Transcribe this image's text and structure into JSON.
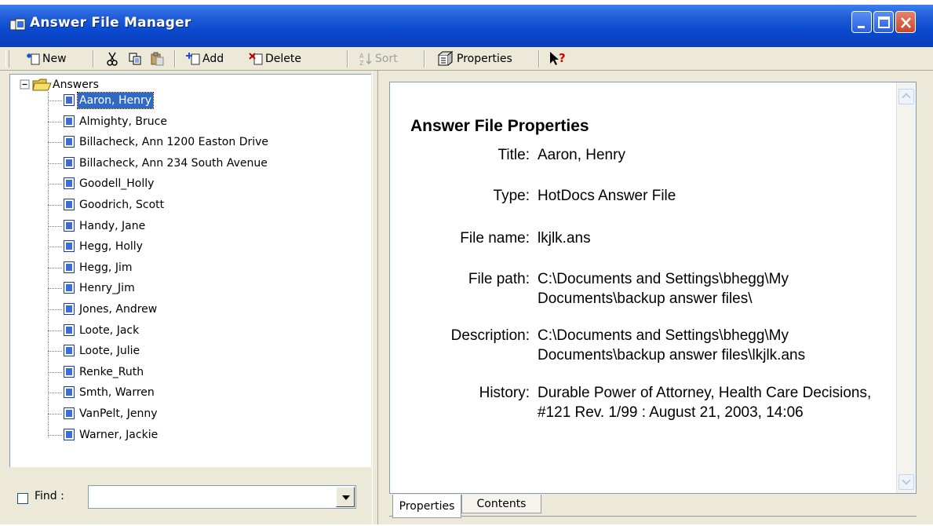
{
  "window": {
    "title": "Answer File Manager",
    "accent_color": "#0a4ad0",
    "controls": [
      "minimize-icon",
      "maximize-icon",
      "close-icon"
    ]
  },
  "toolbar": {
    "new_label": "New",
    "add_label": "Add",
    "delete_label": "Delete",
    "sort_label": "Sort",
    "properties_label": "Properties",
    "icons": [
      "new-icon",
      "cut-icon",
      "copy-icon",
      "paste-icon",
      "add-icon",
      "delete-icon",
      "sort-icon",
      "properties-icon",
      "help-pointer-icon"
    ]
  },
  "tree": {
    "root_label": "Answers",
    "items": [
      {
        "label": "Aaron, Henry",
        "selected": true
      },
      {
        "label": "Almighty, Bruce"
      },
      {
        "label": "Billacheck, Ann 1200 Easton Drive"
      },
      {
        "label": "Billacheck, Ann 234 South Avenue"
      },
      {
        "label": "Goodell_Holly"
      },
      {
        "label": "Goodrich, Scott"
      },
      {
        "label": "Handy, Jane"
      },
      {
        "label": "Hegg, Holly"
      },
      {
        "label": "Hegg, Jim"
      },
      {
        "label": "Henry_Jim"
      },
      {
        "label": "Jones, Andrew"
      },
      {
        "label": "Loote, Jack"
      },
      {
        "label": "Loote, Julie"
      },
      {
        "label": "Renke_Ruth"
      },
      {
        "label": "Smth, Warren"
      },
      {
        "label": "VanPelt, Jenny"
      },
      {
        "label": "Warner, Jackie"
      }
    ]
  },
  "find": {
    "label": "Find :",
    "checked": false,
    "value": ""
  },
  "properties": {
    "heading": "Answer File Properties",
    "rows": [
      {
        "label": "Title:",
        "value": "Aaron, Henry"
      },
      {
        "label": "Type:",
        "value": "HotDocs Answer File"
      },
      {
        "label": "File name:",
        "value": "lkjlk.ans"
      },
      {
        "label": "File path:",
        "value": "C:\\Documents and Settings\\bhegg\\My Documents\\backup answer files\\"
      },
      {
        "label": "Description:",
        "value": "C:\\Documents and Settings\\bhegg\\My Documents\\backup answer files\\lkjlk.ans"
      },
      {
        "label": "History:",
        "value": "Durable Power of Attorney, Health Care Decisions,  #121  Rev. 1/99 : August 21, 2003, 14:06"
      }
    ]
  },
  "tabs": [
    {
      "label": "Properties",
      "active": true
    },
    {
      "label": "Contents",
      "active": false
    }
  ]
}
